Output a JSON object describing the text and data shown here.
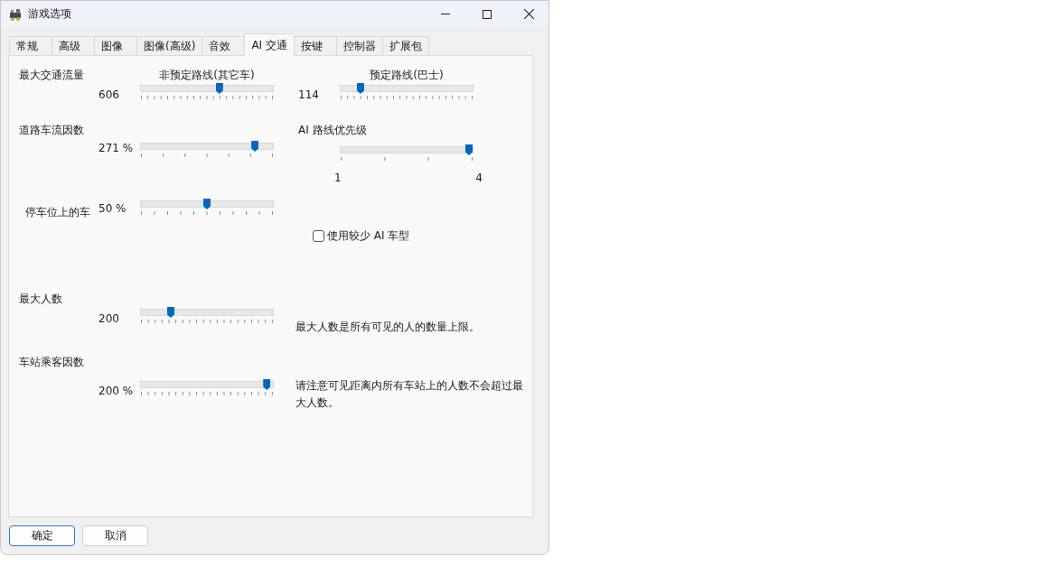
{
  "window": {
    "title": "游戏选项"
  },
  "tabs": [
    {
      "label": "常规",
      "selected": false
    },
    {
      "label": "高级",
      "selected": false
    },
    {
      "label": "图像",
      "selected": false
    },
    {
      "label": "图像(高级)",
      "selected": false
    },
    {
      "label": "音效",
      "selected": false
    },
    {
      "label": "AI 交通",
      "selected": true
    },
    {
      "label": "按键",
      "selected": false
    },
    {
      "label": "控制器",
      "selected": false
    },
    {
      "label": "扩展包",
      "selected": false
    }
  ],
  "max_traffic": {
    "label": "最大交通流量",
    "unscheduled": {
      "caption": "非预定路线(其它车)",
      "reading": "606",
      "level": 0.6
    },
    "scheduled": {
      "caption": "预定路线(巴士)",
      "reading": "114",
      "level": 0.13
    }
  },
  "road_traffic_factor": {
    "label": "道路车流因数",
    "reading": "271 %",
    "level": 0.885
  },
  "ai_route_priority": {
    "label": "AI 路线优先级",
    "min": "1",
    "max": "4",
    "level": 1
  },
  "parked_cars": {
    "label": "停车位上的车",
    "reading": "50 %",
    "level": 0.5
  },
  "fewer_ai_models": {
    "label": "使用较少 AI 车型",
    "checked": false
  },
  "max_people": {
    "label": "最大人数",
    "reading": "200",
    "level": 0.21,
    "note": "最大人数是所有可见的人的数量上限。"
  },
  "station_passenger_factor": {
    "label": "车站乘客因数",
    "reading": "200 %",
    "level": 0.98,
    "note": "请注意可见距离内所有车站上的人数不会超过最大人数。"
  },
  "buttons": [
    {
      "label": "确定",
      "kind": "default"
    },
    {
      "label": "取消",
      "kind": "normal"
    }
  ]
}
